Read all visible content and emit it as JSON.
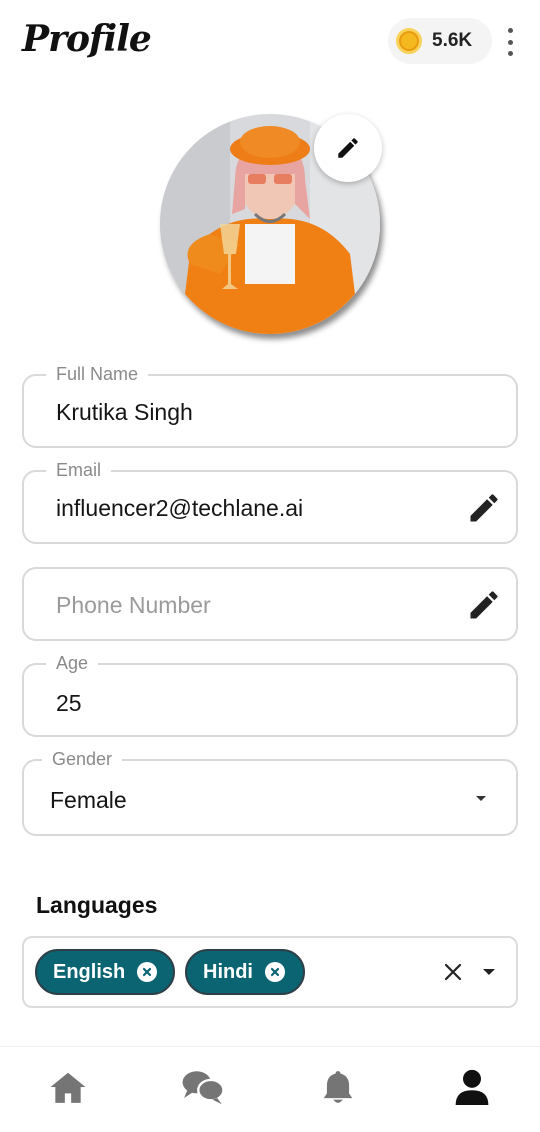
{
  "header": {
    "title": "Profile",
    "coins": "5.6K",
    "coin_icon": "coin-icon",
    "menu_icon": "more-vertical-icon"
  },
  "avatar": {
    "edit_icon": "pencil-icon"
  },
  "form": {
    "full_name": {
      "label": "Full Name",
      "value": "Krutika Singh"
    },
    "email": {
      "label": "Email",
      "value": "influencer2@techlane.ai"
    },
    "phone": {
      "placeholder": "Phone Number"
    },
    "age": {
      "label": "Age",
      "value": "25"
    },
    "gender": {
      "label": "Gender",
      "value": "Female"
    }
  },
  "languages": {
    "title": "Languages",
    "selected": [
      "English",
      "Hindi"
    ]
  },
  "nav": {
    "items": [
      "home-icon",
      "chat-icon",
      "bell-icon",
      "person-icon"
    ],
    "active": "person-icon"
  },
  "colors": {
    "chip": "#0b6472",
    "coin": "#f6b81f",
    "nav_inactive": "#757575",
    "nav_active": "#111111"
  }
}
